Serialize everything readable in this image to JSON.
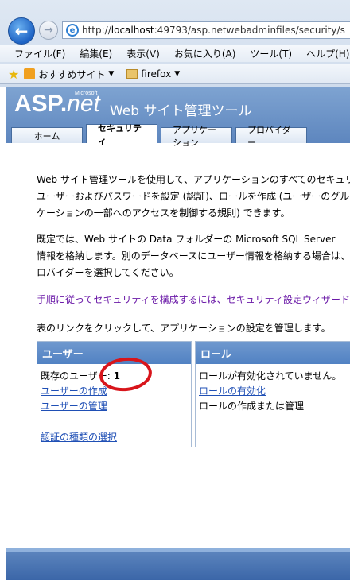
{
  "browser": {
    "address": "http://localhost:49793/asp.netwebadminfiles/security/s",
    "address_host_prefix": "http://",
    "address_host": "localhost",
    "address_rest": ":49793/asp.netwebadminfiles/security/s",
    "menu": [
      "ファイル(F)",
      "編集(E)",
      "表示(V)",
      "お気に入り(A)",
      "ツール(T)",
      "ヘルプ(H)"
    ],
    "favorites": {
      "suggested_sites": "おすすめサイト",
      "folder": "firefox"
    }
  },
  "header": {
    "logo_asp": "ASP",
    "logo_dot": ".",
    "logo_net": "net",
    "logo_ms": "Microsoft",
    "title": "Web サイト管理ツール",
    "tabs": [
      "ホーム",
      "セキュリティ",
      "アプリケーション",
      "プロバイダー"
    ],
    "active_tab": 1
  },
  "intro": {
    "p1": [
      "Web サイト管理ツールを使用して、アプリケーションのすべてのセキュリテ",
      "ユーザーおよびパスワードを設定 (認証)、ロールを作成 (ユーザーのグル",
      "ケーションの一部へのアクセスを制御する規則) できます。"
    ],
    "p2": [
      "既定では、Web サイトの Data フォルダーの Microsoft SQL Server",
      "情報を格納します。別のデータベースにユーザー情報を格納する場合は、",
      "ロバイダーを選択してください。"
    ],
    "wizard_link": "手順に従ってセキュリティを構成するには、セキュリティ設定ウィザードを使",
    "instruction": "表のリンクをクリックして、アプリケーションの設定を管理します。"
  },
  "users_panel": {
    "title": "ユーザー",
    "existing_label": "既存のユーザー:",
    "existing_count": "1",
    "create_link": "ユーザーの作成",
    "manage_link": "ユーザーの管理",
    "auth_link": "認証の種類の選択"
  },
  "roles_panel": {
    "title": "ロール",
    "status": "ロールが有効化されていません。",
    "enable_link": "ロールの有効化",
    "create_manage": "ロールの作成または管理"
  },
  "colors": {
    "header_blue": "#5b84bd",
    "link_blue": "#1f4fb5",
    "visited_purple": "#6b1aa8",
    "highlight_red": "#d8151b"
  }
}
